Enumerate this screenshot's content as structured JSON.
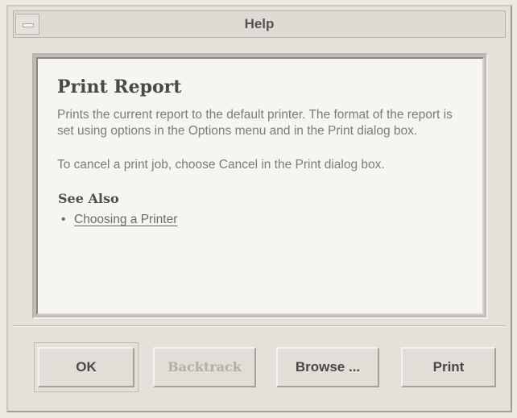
{
  "window": {
    "title": "Help"
  },
  "help": {
    "heading": "Print Report",
    "paragraph1": "Prints the current report to the default printer.  The format of the report is set using options in the Options menu and in the Print dialog box.",
    "paragraph2": "To cancel a print job, choose Cancel in the Print dialog box.",
    "see_also_heading": "See Also",
    "links": [
      {
        "label": "Choosing a Printer"
      }
    ]
  },
  "buttons": {
    "ok": "OK",
    "backtrack": "Backtrack",
    "browse": "Browse ...",
    "print": "Print"
  },
  "colors": {
    "window_bg": "#e3e1da",
    "content_bg": "#f6f5f0",
    "text_muted": "#7d7b75",
    "disabled_text": "#b0aea7"
  },
  "icons": {
    "window_menu": "window-menu-icon",
    "bullet": "bullet-icon"
  }
}
